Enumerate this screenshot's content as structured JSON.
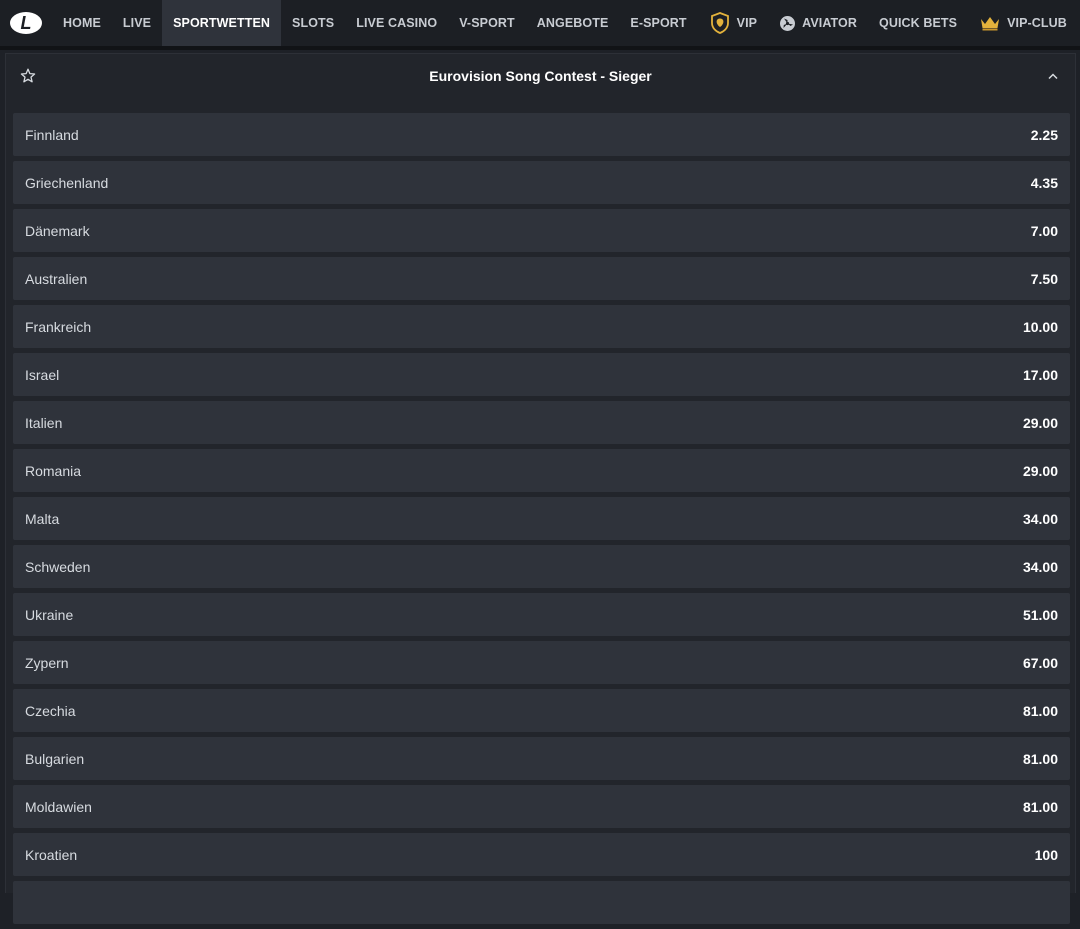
{
  "nav": {
    "logo_letter": "L",
    "items": [
      {
        "label": "HOME",
        "active": false
      },
      {
        "label": "LIVE",
        "active": false
      },
      {
        "label": "SPORTWETTEN",
        "active": true
      },
      {
        "label": "SLOTS",
        "active": false
      },
      {
        "label": "LIVE CASINO",
        "active": false
      },
      {
        "label": "V-SPORT",
        "active": false
      },
      {
        "label": "ANGEBOTE",
        "active": false
      },
      {
        "label": "E-SPORT",
        "active": false
      },
      {
        "label": "VIP",
        "active": false,
        "icon": "lion-shield-icon"
      },
      {
        "label": "AVIATOR",
        "active": false,
        "icon": "propeller-icon"
      },
      {
        "label": "QUICK BETS",
        "active": false
      },
      {
        "label": "VIP-CLUB",
        "active": false,
        "icon": "crown-icon"
      }
    ]
  },
  "market": {
    "title": "Eurovision Song Contest - Sieger",
    "favorite_icon": "star-outline-icon",
    "collapse_icon": "chevron-up-icon",
    "selections": [
      {
        "name": "Finnland",
        "odds": "2.25"
      },
      {
        "name": "Griechenland",
        "odds": "4.35"
      },
      {
        "name": "Dänemark",
        "odds": "7.00"
      },
      {
        "name": "Australien",
        "odds": "7.50"
      },
      {
        "name": "Frankreich",
        "odds": "10.00"
      },
      {
        "name": "Israel",
        "odds": "17.00"
      },
      {
        "name": "Italien",
        "odds": "29.00"
      },
      {
        "name": "Romania",
        "odds": "29.00"
      },
      {
        "name": "Malta",
        "odds": "34.00"
      },
      {
        "name": "Schweden",
        "odds": "34.00"
      },
      {
        "name": "Ukraine",
        "odds": "51.00"
      },
      {
        "name": "Zypern",
        "odds": "67.00"
      },
      {
        "name": "Czechia",
        "odds": "81.00"
      },
      {
        "name": "Bulgarien",
        "odds": "81.00"
      },
      {
        "name": "Moldawien",
        "odds": "81.00"
      },
      {
        "name": "Kroatien",
        "odds": "100"
      },
      {
        "name": "",
        "odds": ""
      }
    ]
  },
  "colors": {
    "background": "#1e2127",
    "nav_background": "#1c1f24",
    "nav_active": "#2f333b",
    "row_background": "#2f333b",
    "vip_gold": "#e3b23c"
  }
}
